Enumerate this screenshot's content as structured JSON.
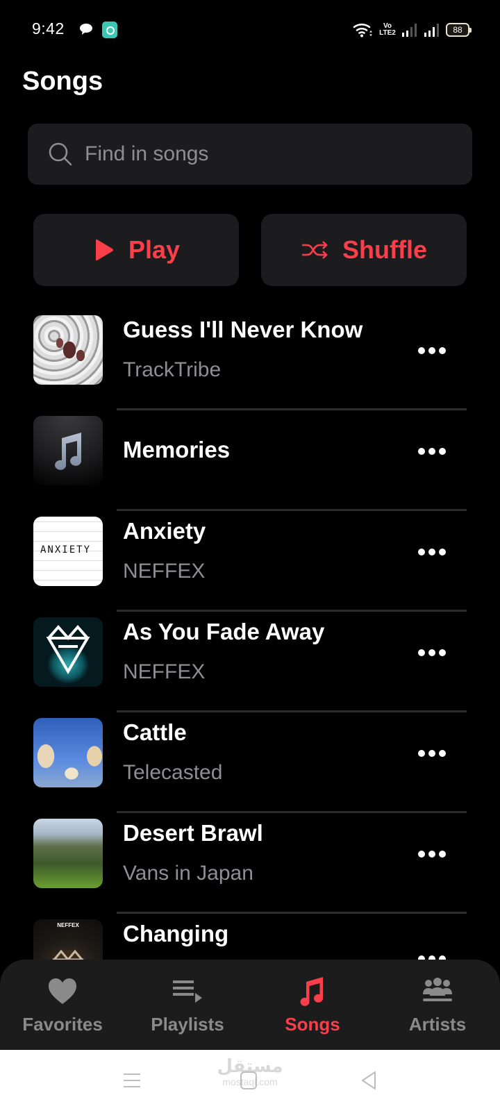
{
  "status_bar": {
    "time": "9:42",
    "network_label": "VoLTE2",
    "volte_line1": "Vo",
    "volte_line2": "LTE2",
    "battery": "88"
  },
  "header": {
    "title": "Songs"
  },
  "search": {
    "placeholder": "Find in songs",
    "value": ""
  },
  "actions": {
    "play_label": "Play",
    "shuffle_label": "Shuffle"
  },
  "accent_color": "#fa3f4b",
  "songs": [
    {
      "title": "Guess I'll Never Know",
      "artist": "TrackTribe",
      "art": "abstract-pattern-art"
    },
    {
      "title": "Memories",
      "artist": "",
      "art": "music-note-placeholder"
    },
    {
      "title": "Anxiety",
      "artist": "NEFFEX",
      "art": "anxiety-cover-art"
    },
    {
      "title": "As You Fade Away",
      "artist": "NEFFEX",
      "art": "neffex-teal-cover-art"
    },
    {
      "title": "Cattle",
      "artist": "Telecasted",
      "art": "cows-photo-art"
    },
    {
      "title": "Desert Brawl",
      "artist": "Vans in Japan",
      "art": "house-photo-art"
    },
    {
      "title": "Changing",
      "artist": "",
      "art": "neffex-logo-art",
      "art_text": "NEFFEX"
    }
  ],
  "tab_bar": {
    "tabs": [
      {
        "label": "Favorites",
        "icon": "heart-icon",
        "active": false
      },
      {
        "label": "Playlists",
        "icon": "playlist-icon",
        "active": false
      },
      {
        "label": "Songs",
        "icon": "music-note-icon",
        "active": true
      },
      {
        "label": "Artists",
        "icon": "people-icon",
        "active": false
      }
    ]
  },
  "system_nav": {
    "watermark_top": "مستقل",
    "watermark_bottom": "mostaql.com"
  }
}
